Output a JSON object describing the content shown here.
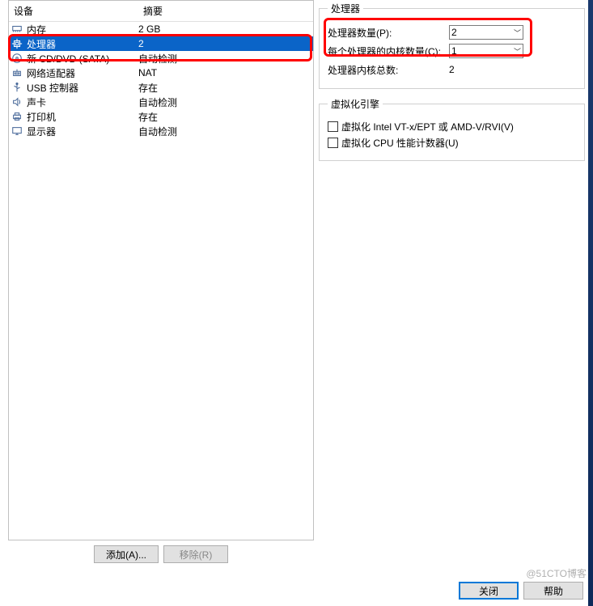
{
  "headers": {
    "device": "设备",
    "summary": "摘要"
  },
  "devices": [
    {
      "icon": "memory-icon",
      "label": "内存",
      "summary": "2 GB",
      "selected": false
    },
    {
      "icon": "cpu-icon",
      "label": "处理器",
      "summary": "2",
      "selected": true
    },
    {
      "icon": "cd-icon",
      "label": "新 CD/DVD (SATA)",
      "summary": "自动检测",
      "selected": false
    },
    {
      "icon": "network-icon",
      "label": "网络适配器",
      "summary": "NAT",
      "selected": false
    },
    {
      "icon": "usb-icon",
      "label": "USB 控制器",
      "summary": "存在",
      "selected": false
    },
    {
      "icon": "sound-icon",
      "label": "声卡",
      "summary": "自动检测",
      "selected": false
    },
    {
      "icon": "printer-icon",
      "label": "打印机",
      "summary": "存在",
      "selected": false
    },
    {
      "icon": "display-icon",
      "label": "显示器",
      "summary": "自动检测",
      "selected": false
    }
  ],
  "buttons": {
    "add": "添加(A)...",
    "remove": "移除(R)",
    "close": "关闭",
    "help": "帮助"
  },
  "processor_group": {
    "legend": "处理器",
    "count_label": "处理器数量(P):",
    "count_value": "2",
    "cores_label": "每个处理器的内核数量(C):",
    "cores_value": "1",
    "total_label": "处理器内核总数:",
    "total_value": "2"
  },
  "virt_group": {
    "legend": "虚拟化引擎",
    "vt_label": "虚拟化 Intel VT-x/EPT 或 AMD-V/RVI(V)",
    "perf_label": "虚拟化 CPU 性能计数器(U)"
  },
  "watermark": "@51CTO博客"
}
